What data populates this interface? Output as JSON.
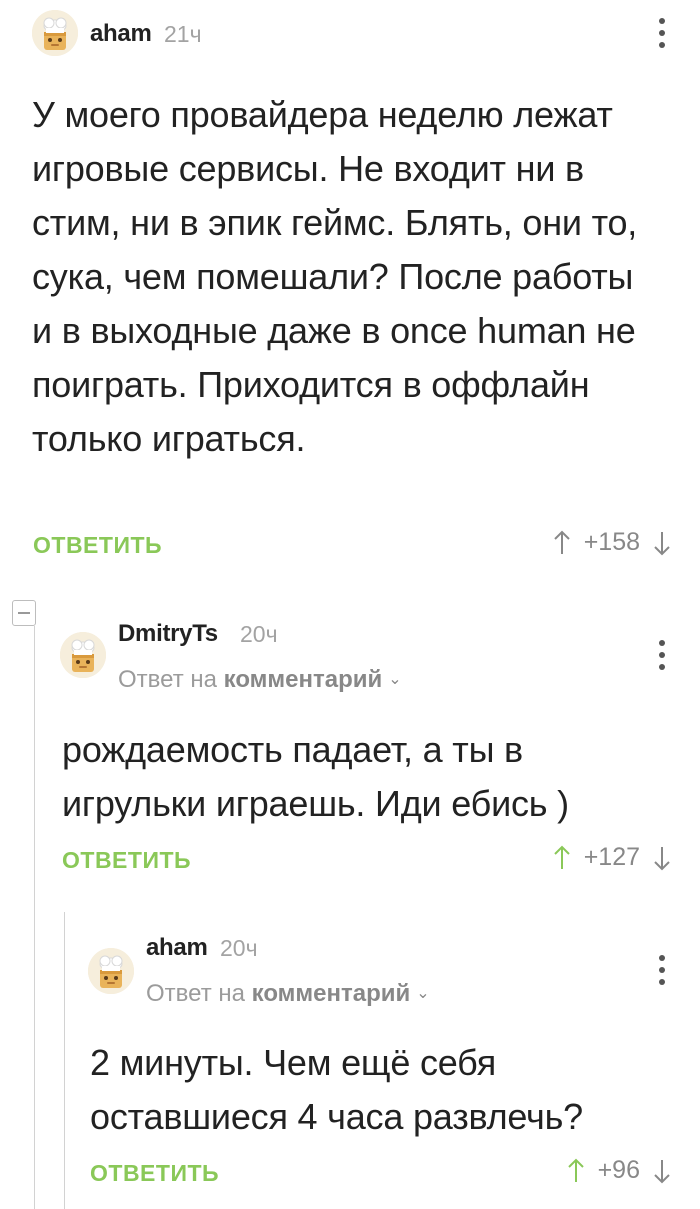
{
  "comments": [
    {
      "username": "aham",
      "time": "21ч",
      "reply_to": null,
      "text": "У моего провайдера неделю лежат игровые сервисы. Не входит ни в стим, ни в эпик геймс. Блять, они то, сука, чем помешали? После работы и в выходные даже в once human не поиграть. Приходится в оффлайн только играться.",
      "reply_label": "ОТВЕТИТЬ",
      "rating": "+158"
    },
    {
      "username": "DmitryTs",
      "time": "20ч",
      "reply_to": {
        "prefix": "Ответ на",
        "link": "комментарий"
      },
      "text": "рождаемость падает, а ты в игрульки играешь. Иди ебись )",
      "reply_label": "ОТВЕТИТЬ",
      "rating": "+127"
    },
    {
      "username": "aham",
      "time": "20ч",
      "reply_to": {
        "prefix": "Ответ на",
        "link": "комментарий"
      },
      "text": "2 минуты. Чем ещё себя оставшиеся 4 часа развлечь?",
      "reply_label": "ОТВЕТИТЬ",
      "rating": "+96"
    }
  ],
  "colors": {
    "reply_button": "#8ac858",
    "upvote_green": "#8ac858",
    "muted_text": "#9b9b9b",
    "thread_line": "#d2d2d2"
  },
  "icons": [
    "avatar-default-chef",
    "more-vertical-icon",
    "arrow-up-icon",
    "arrow-down-icon",
    "collapse-thread-icon",
    "chevron-down-icon"
  ]
}
